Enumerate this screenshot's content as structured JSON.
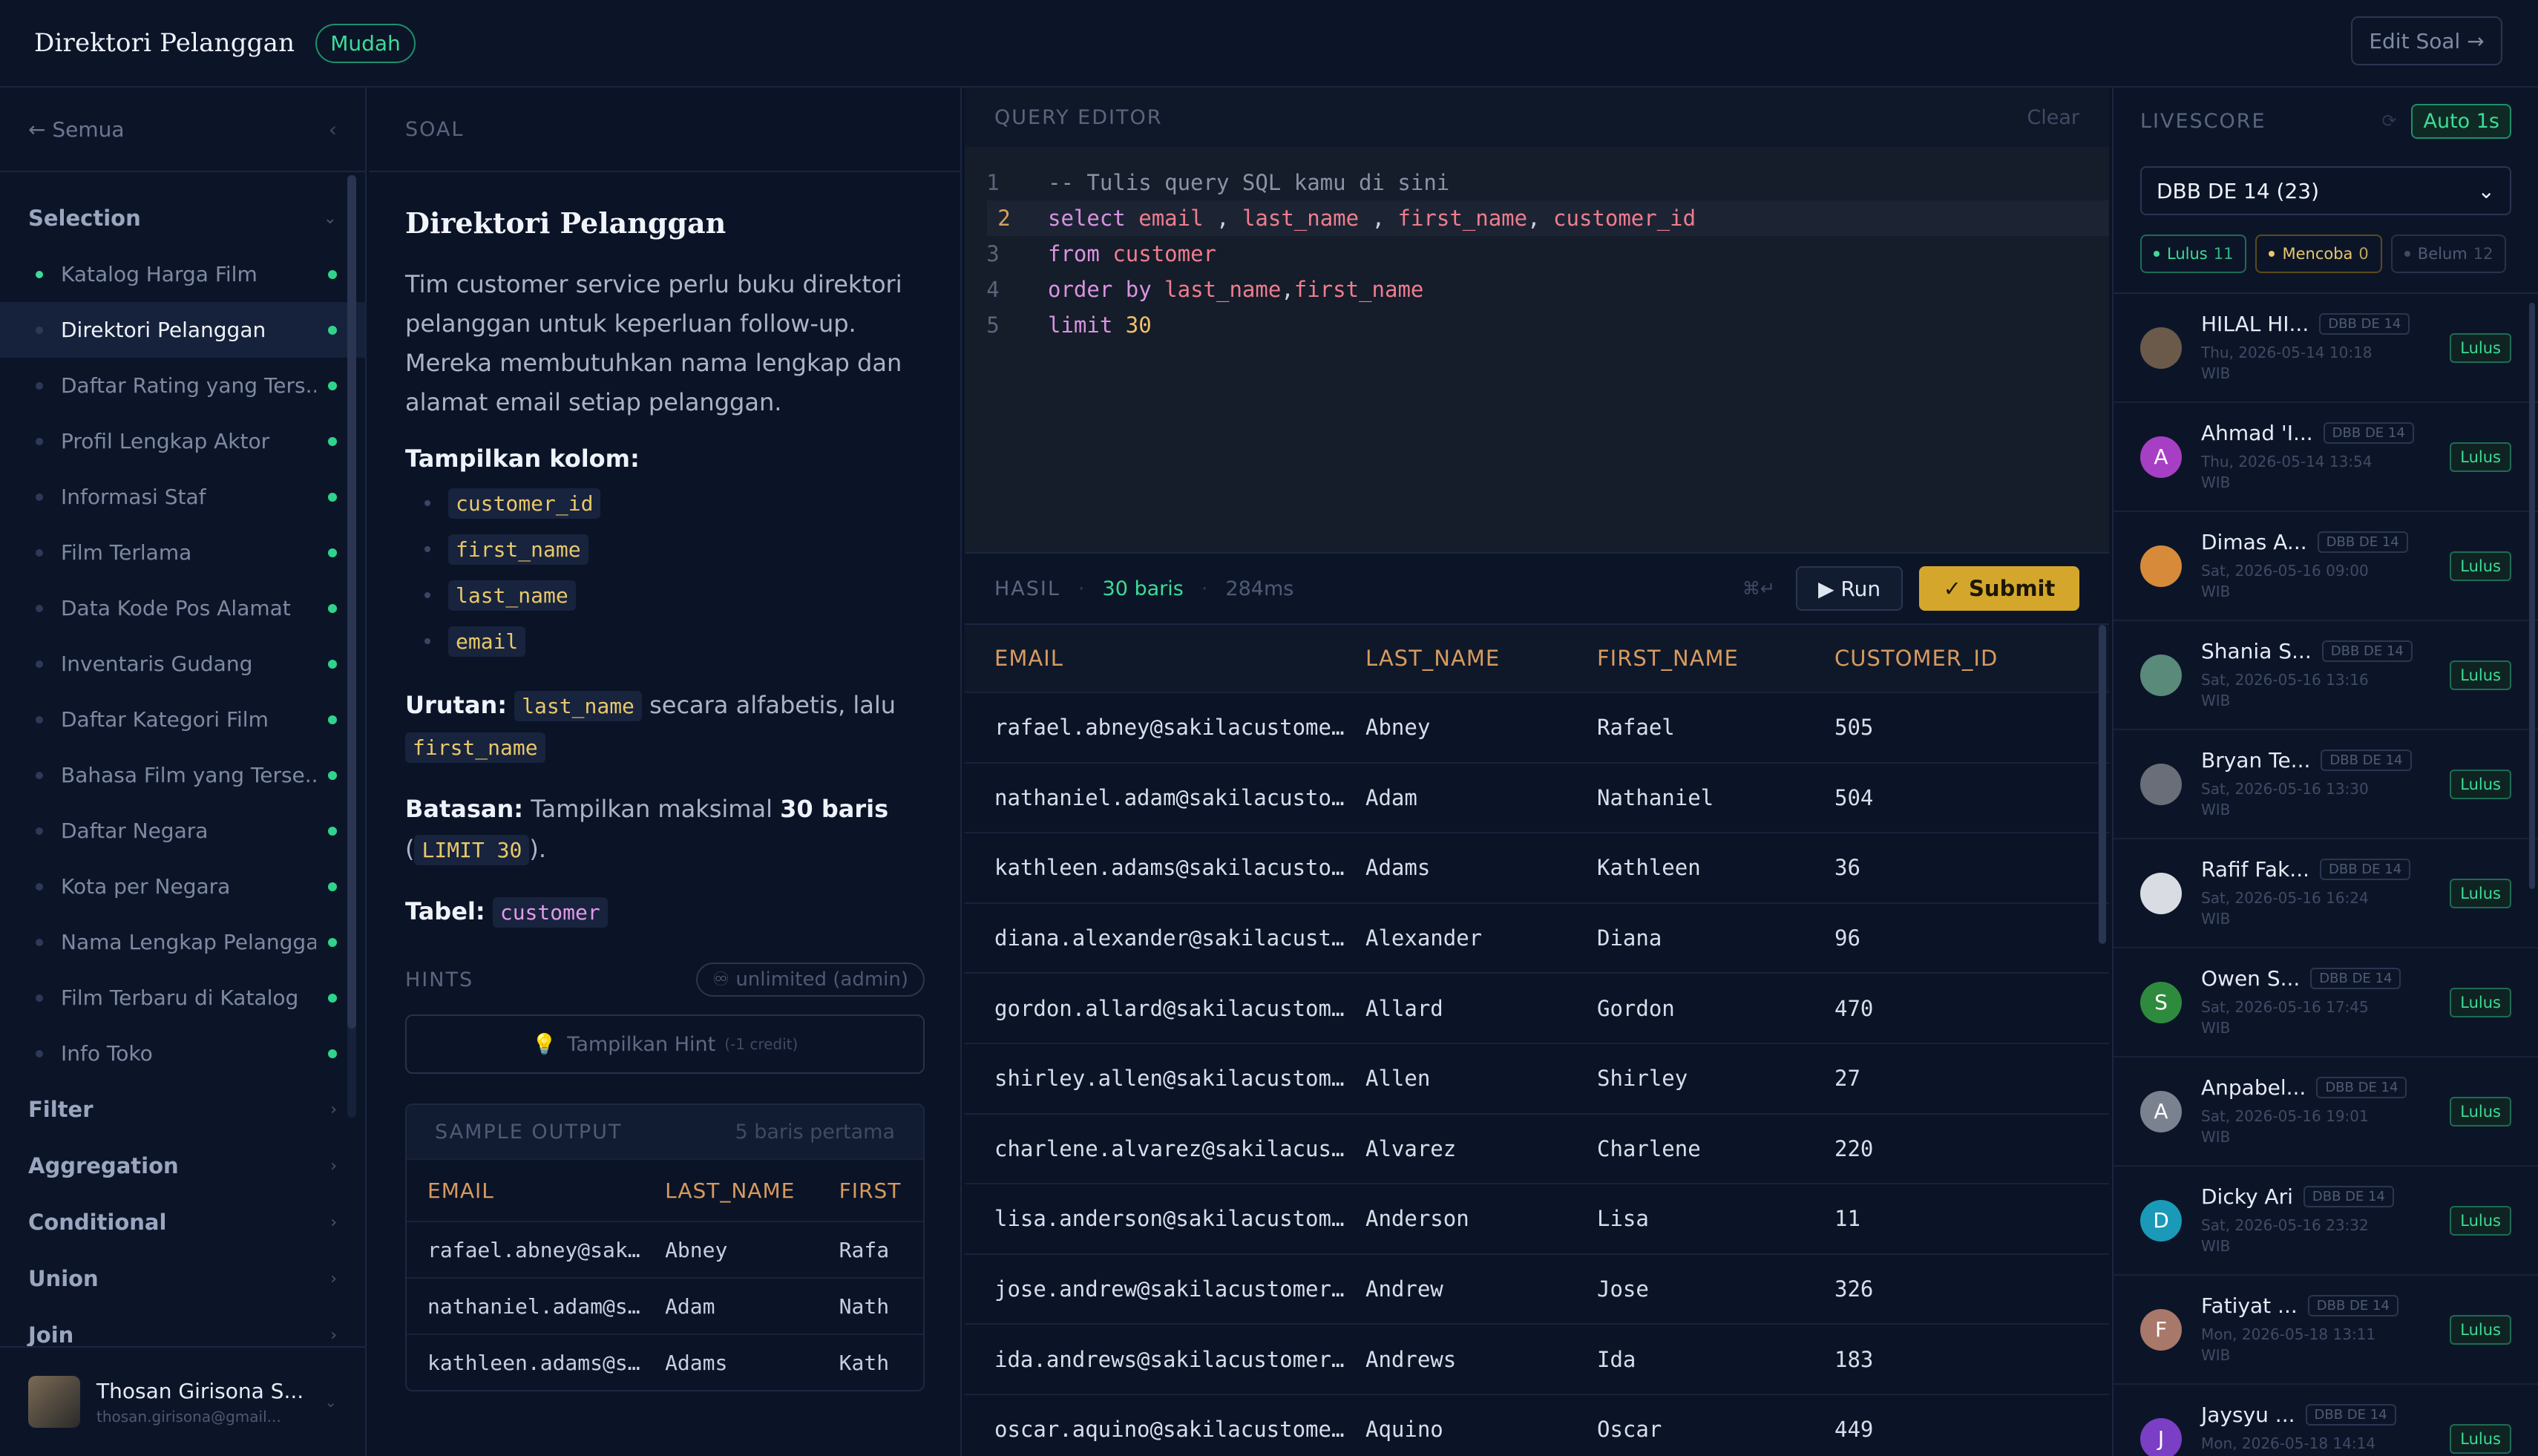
{
  "header": {
    "title": "Direktori Pelanggan",
    "difficulty": "Mudah",
    "edit_label": "Edit Soal →"
  },
  "sidebar": {
    "back_label": "← Semua",
    "collapse_icon": "‹",
    "sections": [
      {
        "label": "Selection",
        "chev": "⌄"
      },
      {
        "label": "Filter",
        "chev": "›"
      },
      {
        "label": "Aggregation",
        "chev": "›"
      },
      {
        "label": "Conditional",
        "chev": "›"
      },
      {
        "label": "Union",
        "chev": "›"
      },
      {
        "label": "Join",
        "chev": "›"
      }
    ],
    "items": [
      "Katalog Harga Film",
      "Direktori Pelanggan",
      "Daftar Rating yang Ters...",
      "Profil Lengkap Aktor",
      "Informasi Staf",
      "Film Terlama",
      "Data Kode Pos Alamat",
      "Inventaris Gudang",
      "Daftar Kategori Film",
      "Bahasa Film yang Terse...",
      "Daftar Negara",
      "Kota per Negara",
      "Nama Lengkap Pelanggan",
      "Film Terbaru di Katalog",
      "Info Toko"
    ],
    "user": {
      "name": "Thosan Girisona S...",
      "email": "thosan.girisona@gmail..."
    }
  },
  "problem": {
    "panel_label": "SOAL",
    "title": "Direktori Pelanggan",
    "description": "Tim customer service perlu buku direktori pelanggan untuk keperluan follow-up. Mereka membutuhkan nama lengkap dan alamat email setiap pelanggan.",
    "columns_label": "Tampilkan kolom:",
    "columns": [
      "customer_id",
      "first_name",
      "last_name",
      "email"
    ],
    "order_label": "Urutan:",
    "order_col1": "last_name",
    "order_text": "secara alfabetis, lalu",
    "order_col2": "first_name",
    "limit_label": "Batasan:",
    "limit_text": "Tampilkan maksimal",
    "limit_bold": "30 baris",
    "limit_open": "(",
    "limit_code": "LIMIT 30",
    "limit_close": ").",
    "table_label": "Tabel:",
    "table_name": "customer",
    "hints_label": "HINTS",
    "hints_pill": "♾ unlimited (admin)",
    "hint_button": "Tampilkan Hint",
    "hint_credit": "(-1 credit)",
    "sample_label": "SAMPLE OUTPUT",
    "sample_note": "5 baris pertama",
    "sample_headers": [
      "EMAIL",
      "LAST_NAME",
      "FIRST"
    ],
    "sample_rows": [
      [
        "rafael.abney@sak…",
        "Abney",
        "Rafa"
      ],
      [
        "nathaniel.adam@s…",
        "Adam",
        "Nath"
      ],
      [
        "kathleen.adams@s…",
        "Adams",
        "Kath"
      ]
    ]
  },
  "editor": {
    "label": "QUERY EDITOR",
    "clear_label": "Clear",
    "lines": [
      "1",
      "2",
      "3",
      "4",
      "5"
    ]
  },
  "result": {
    "label": "HASIL",
    "rows_label": "30 baris",
    "time_label": "284ms",
    "kbd_hint": "⌘↵",
    "run_label": "▶ Run",
    "submit_label": "✓ Submit",
    "headers": [
      "EMAIL",
      "LAST_NAME",
      "FIRST_NAME",
      "CUSTOMER_ID"
    ],
    "rows": [
      [
        "rafael.abney@sakilacustome…",
        "Abney",
        "Rafael",
        "505"
      ],
      [
        "nathaniel.adam@sakilacusto…",
        "Adam",
        "Nathaniel",
        "504"
      ],
      [
        "kathleen.adams@sakilacusto…",
        "Adams",
        "Kathleen",
        "36"
      ],
      [
        "diana.alexander@sakilacust…",
        "Alexander",
        "Diana",
        "96"
      ],
      [
        "gordon.allard@sakilacustom…",
        "Allard",
        "Gordon",
        "470"
      ],
      [
        "shirley.allen@sakilacustom…",
        "Allen",
        "Shirley",
        "27"
      ],
      [
        "charlene.alvarez@sakilacus…",
        "Alvarez",
        "Charlene",
        "220"
      ],
      [
        "lisa.anderson@sakilacustom…",
        "Anderson",
        "Lisa",
        "11"
      ],
      [
        "jose.andrew@sakilacustomer…",
        "Andrew",
        "Jose",
        "326"
      ],
      [
        "ida.andrews@sakilacustomer…",
        "Andrews",
        "Ida",
        "183"
      ],
      [
        "oscar.aquino@sakilacustome…",
        "Aquino",
        "Oscar",
        "449"
      ]
    ]
  },
  "livescore": {
    "label": "LIVESCORE",
    "refresh_icon": "⟳",
    "auto_label": "Auto 1s",
    "selected": "DBB DE 14 (23)",
    "select_chev": "⌄",
    "counts": [
      {
        "label": "Lulus",
        "n": "11"
      },
      {
        "label": "Mencoba",
        "n": "0"
      },
      {
        "label": "Belum",
        "n": "12"
      }
    ],
    "entries": [
      {
        "name": "HILAL HI...",
        "initial": "",
        "color": "#6b5a4a",
        "tag": "DBB DE 14",
        "time": "Thu, 2026-05-14 10:18 WIB",
        "status": "Lulus"
      },
      {
        "name": "Ahmad 'I...",
        "initial": "A",
        "color": "#a63fc4",
        "tag": "DBB DE 14",
        "time": "Thu, 2026-05-14 13:54 WIB",
        "status": "Lulus"
      },
      {
        "name": "Dimas A...",
        "initial": "",
        "color": "#d68a3a",
        "tag": "DBB DE 14",
        "time": "Sat, 2026-05-16 09:00 WIB",
        "status": "Lulus"
      },
      {
        "name": "Shania S...",
        "initial": "",
        "color": "#5a8a7a",
        "tag": "DBB DE 14",
        "time": "Sat, 2026-05-16 13:16 WIB",
        "status": "Lulus"
      },
      {
        "name": "Bryan Te...",
        "initial": "",
        "color": "#6a6e78",
        "tag": "DBB DE 14",
        "time": "Sat, 2026-05-16 13:30 WIB",
        "status": "Lulus"
      },
      {
        "name": "Rafif Fak...",
        "initial": "",
        "color": "#d9dce2",
        "tag": "DBB DE 14",
        "time": "Sat, 2026-05-16 16:24 WIB",
        "status": "Lulus"
      },
      {
        "name": "Owen S...",
        "initial": "S",
        "color": "#2e8b3e",
        "tag": "DBB DE 14",
        "time": "Sat, 2026-05-16 17:45 WIB",
        "status": "Lulus"
      },
      {
        "name": "Anpabel...",
        "initial": "A",
        "color": "#7a8290",
        "tag": "DBB DE 14",
        "time": "Sat, 2026-05-16 19:01 WIB",
        "status": "Lulus"
      },
      {
        "name": "Dicky Ari",
        "initial": "D",
        "color": "#1a9ab8",
        "tag": "DBB DE 14",
        "time": "Sat, 2026-05-16 23:32 WIB",
        "status": "Lulus"
      },
      {
        "name": "Fatiyat ...",
        "initial": "F",
        "color": "#a8786a",
        "tag": "DBB DE 14",
        "time": "Mon, 2026-05-18 13:11 WIB",
        "status": "Lulus"
      },
      {
        "name": "Jaysyu ...",
        "initial": "J",
        "color": "#7a3fc4",
        "tag": "DBB DE 14",
        "time": "Mon, 2026-05-18 14:14 WIB",
        "status": "Lulus"
      }
    ]
  }
}
